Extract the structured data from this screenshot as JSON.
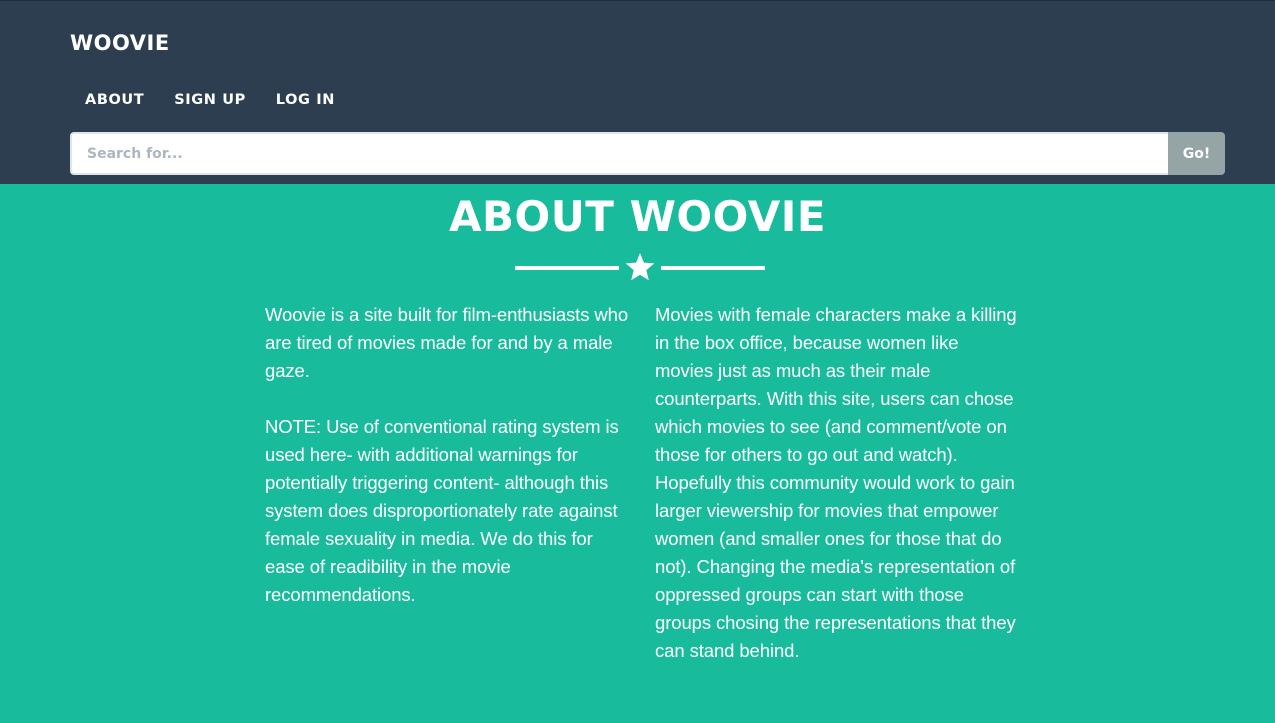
{
  "navbar": {
    "brand": "WOOVIE",
    "links": [
      "ABOUT",
      "SIGN UP",
      "LOG IN"
    ]
  },
  "search": {
    "placeholder": "Search for...",
    "button_label": "Go!"
  },
  "about": {
    "title": "ABOUT WOOVIE",
    "divider_icon": "star-icon",
    "left_paragraphs": [
      "Woovie is a site built for film-enthusiasts who are tired of movies made for and by a male gaze.",
      "NOTE: Use of conventional rating system is used here- with additional warnings for potentially triggering content- although this system does disproportionately rate against female sexuality in media. We do this for ease of readibility in the movie recommendations."
    ],
    "right_paragraphs": [
      "Movies with female characters make a killing in the box office, because women like movies just as much as their male counterparts. With this site, users can chose which movies to see (and comment/vote on those for others to go out and watch). Hopefully this community would work to gain larger viewership for movies that empower women (and smaller ones for those that do not). Changing the media's representation of oppressed groups can start with those groups chosing the representations that they can stand behind."
    ]
  },
  "colors": {
    "navbar_bg": "#2c3e50",
    "about_bg": "#18bc9c",
    "button_bg": "#95a5a6",
    "text": "#ffffff"
  }
}
